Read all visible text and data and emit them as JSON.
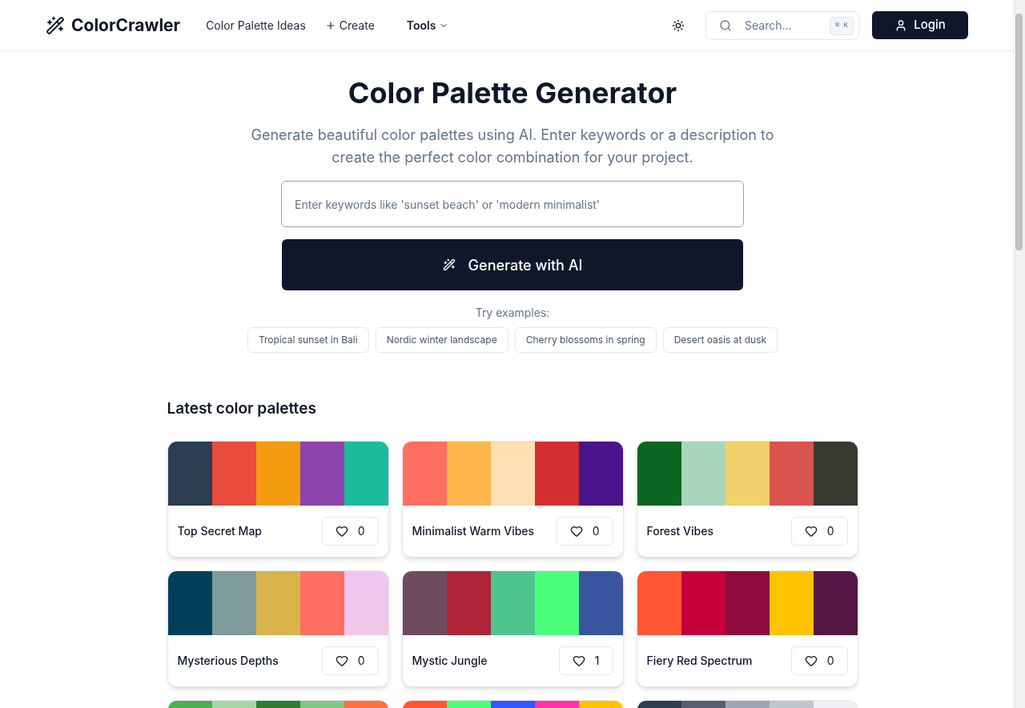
{
  "header": {
    "brand": "ColorCrawler",
    "nav": [
      {
        "kind": "link",
        "label": "Color Palette Ideas"
      },
      {
        "kind": "create",
        "label": "Create"
      },
      {
        "kind": "menu",
        "label": "Tools"
      }
    ],
    "search": {
      "placeholder": "Search...",
      "shortcut": "⌘ K"
    },
    "login": "Login"
  },
  "hero": {
    "title": "Color Palette Generator",
    "subtitle": "Generate beautiful color palettes using AI. Enter keywords or a description to create the perfect color combination for your project.",
    "input": {
      "placeholder": "Enter keywords like 'sunset beach' or 'modern minimalist'"
    },
    "button": "Generate with AI",
    "examples_label": "Try examples:",
    "examples": [
      "Tropical sunset in Bali",
      "Nordic winter landscape",
      "Cherry blossoms in spring",
      "Desert oasis at dusk"
    ]
  },
  "latest": {
    "title": "Latest color palettes",
    "palettes": [
      {
        "name": "Top Secret Map",
        "likes": "0",
        "swatches": [
          {
            "color": "#2c3e50"
          },
          {
            "color": "#e74c3c"
          },
          {
            "color": "#f39c12"
          },
          {
            "color": "#8e44ad"
          },
          {
            "color": "#1abc9c"
          }
        ]
      },
      {
        "name": "Minimalist Warm Vibes",
        "likes": "0",
        "swatches": [
          {
            "color": "#ff6f61"
          },
          {
            "color": "#ffb74d"
          },
          {
            "color": "#ffe0b2"
          },
          {
            "color": "#d32f2f"
          },
          {
            "color": "#4a148c"
          }
        ]
      },
      {
        "name": "Forest Vibes",
        "likes": "0",
        "swatches": [
          {
            "color": "#0b6623"
          },
          {
            "color": "#a8d5ba"
          },
          {
            "color": "#f2d06b"
          },
          {
            "color": "#d9534f"
          },
          {
            "color": "#3a3a33"
          }
        ]
      },
      {
        "name": "Mysterious Depths",
        "likes": "0",
        "swatches": [
          {
            "color": "#003f5c"
          },
          {
            "color": "#7f9a9b"
          },
          {
            "color": "#d9b44a"
          },
          {
            "color": "#ff6f61"
          },
          {
            "color": "#f1c6ec"
          }
        ]
      },
      {
        "name": "Mystic Jungle",
        "likes": "1",
        "swatches": [
          {
            "color": "#6d4c5e"
          },
          {
            "color": "#b0243a"
          },
          {
            "color": "#50c48f"
          },
          {
            "color": "#4cff7a"
          },
          {
            "color": "#3a55a0"
          }
        ]
      },
      {
        "name": "Fiery Red Spectrum",
        "likes": "0",
        "swatches": [
          {
            "color": "#ff5733"
          },
          {
            "color": "#c70039"
          },
          {
            "color": "#900c3f"
          },
          {
            "color": "#ffc300"
          },
          {
            "color": "#581845"
          }
        ]
      },
      {
        "swatches": [
          {
            "color": "#4caf50"
          },
          {
            "color": "#a5d6a7"
          },
          {
            "color": "#2e7d32"
          },
          {
            "color": "#81c784"
          },
          {
            "color": "#ff7043"
          }
        ]
      },
      {
        "swatches": [
          {
            "color": "#ff5733"
          },
          {
            "color": "#4cff7a"
          },
          {
            "color": "#3357ff"
          },
          {
            "color": "#ff33a8"
          },
          {
            "color": "#ffc300"
          }
        ]
      },
      {
        "swatches": [
          {
            "color": "#2c3e50"
          },
          {
            "color": "#56606f"
          },
          {
            "color": "#a0a8b4"
          },
          {
            "color": "#c0c6cf"
          },
          {
            "color": "#eef0f3"
          }
        ]
      }
    ]
  }
}
